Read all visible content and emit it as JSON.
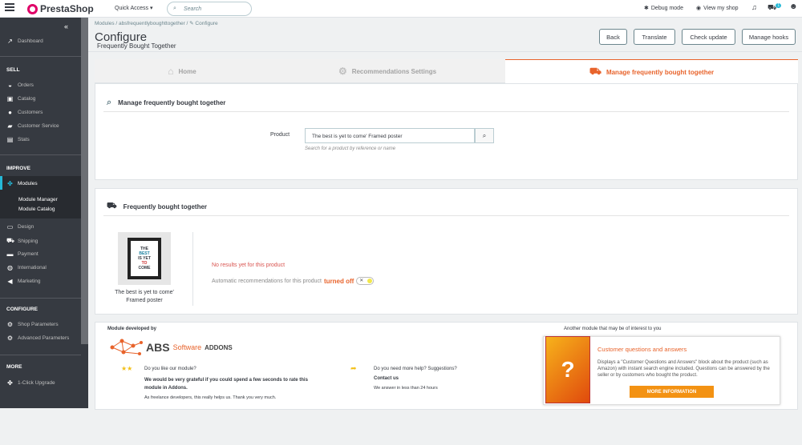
{
  "topbar": {
    "brand": "PrestaShop",
    "quick_access": "Quick Access ▾",
    "search_placeholder": "Search",
    "debug": "Debug mode",
    "view_shop": "View my shop",
    "cart_badge": "1"
  },
  "sidebar": {
    "dashboard": "Dashboard",
    "sec_sell": "SELL",
    "orders": "Orders",
    "catalog": "Catalog",
    "customers": "Customers",
    "customer_service": "Customer Service",
    "stats": "Stats",
    "sec_improve": "IMPROVE",
    "modules": "Modules",
    "module_manager": "Module Manager",
    "module_catalog": "Module Catalog",
    "design": "Design",
    "shipping": "Shipping",
    "payment": "Payment",
    "international": "International",
    "marketing": "Marketing",
    "sec_configure": "CONFIGURE",
    "shop_parameters": "Shop Parameters",
    "advanced_parameters": "Advanced Parameters",
    "sec_more": "MORE",
    "upgrade": "1-Click Upgrade"
  },
  "header": {
    "breadcrumb": "Modules  /  absfrequentlyboughttogether  /  ✎ Configure",
    "title": "Configure",
    "subtitle": "Frequently Bought Together",
    "buttons": {
      "back": "Back",
      "translate": "Translate",
      "check_update": "Check update",
      "manage_hooks": "Manage hooks"
    }
  },
  "tabs": {
    "home": "Home",
    "recommendations": "Recommendations Settings",
    "manage": "Manage frequently bought together"
  },
  "manage_panel": {
    "heading": "Manage frequently bought together",
    "product_label": "Product",
    "product_value": "The best is yet to come' Framed poster",
    "help": "Search for a product by reference or name"
  },
  "fbt_panel": {
    "heading": "Frequently bought together",
    "poster_lines": [
      "THE",
      "BEST",
      "IS YET",
      "TO",
      "COME"
    ],
    "product_name": "The best is yet to come' Framed poster",
    "no_results": "No results yet for this product",
    "auto_text": "Automatic recommendations for this product",
    "auto_state": "turned off"
  },
  "footer": {
    "developed_by": "Module developed by",
    "abs": "ABS",
    "software": "Software",
    "addons": "ADDONS",
    "like_q": "Do you like our module?",
    "like_bold": "We would be very grateful if you could spend a few seconds to rate this module in Addons.",
    "like_note": "As freelance developers, this really helps us. Thank you very much.",
    "help_q": "Do you need more help? Suggestions?",
    "contact": "Contact us",
    "answer_time": "We answer in less than 24 hours",
    "another": "Another module that may be of interest to you",
    "ad_title": "Customer questions and answers",
    "ad_desc": "Displays a \"Customer Questions and Answers\" block about the product (such as Amazon) with instant search engine included. Questions can be answered by the seller or by customers who bought the product.",
    "ad_button": "MORE INFORMATION"
  },
  "colors": {
    "accent": "#25b9d7",
    "orange": "#e8632b",
    "sidebar": "#363a41"
  }
}
